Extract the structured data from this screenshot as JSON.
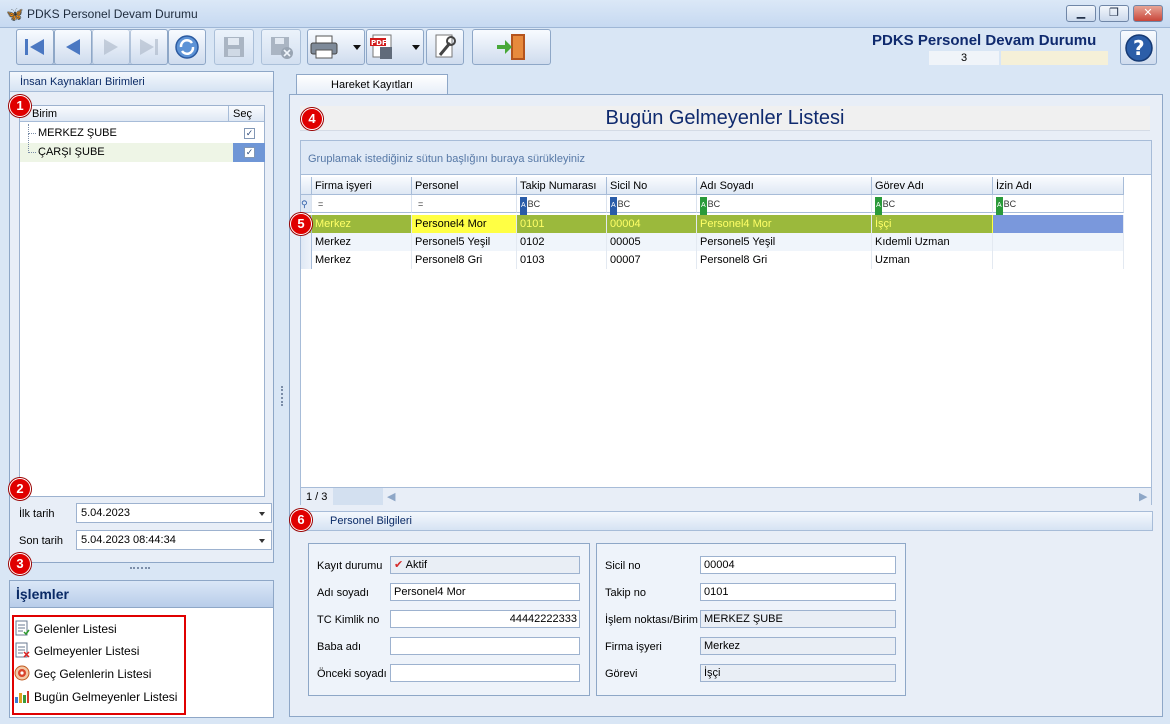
{
  "window": {
    "title": "PDKS Personel Devam Durumu",
    "minimize": "▁",
    "restore": "❐",
    "close": "✕"
  },
  "header": {
    "title": "PDKS Personel Devam Durumu",
    "count": "3",
    "help_icon": "help-icon"
  },
  "toolbar": {
    "icons": [
      "first-record-icon",
      "previous-record-icon",
      "next-record-icon",
      "last-record-icon",
      "refresh-icon",
      "save-icon",
      "delete-icon",
      "print-icon",
      "pdf-export-icon",
      "settings-icon",
      "exit-icon"
    ]
  },
  "left": {
    "caption": "İnsan Kaynakları Birimleri",
    "tree_header": {
      "col1": "Birim",
      "col2": "Seç"
    },
    "units": [
      {
        "label": "MERKEZ ŞUBE",
        "checked": "✓"
      },
      {
        "label": "ÇARŞI ŞUBE",
        "checked": "✓"
      }
    ],
    "first_date_label": "İlk tarih",
    "first_date_value": "5.04.2023",
    "last_date_label": "Son tarih",
    "last_date_value": "5.04.2023 08:44:34"
  },
  "operations": {
    "title": "İşlemler",
    "items": [
      {
        "label": "Gelenler Listesi",
        "icon": "list-arrived-icon"
      },
      {
        "label": "Gelmeyenler Listesi",
        "icon": "list-absent-icon"
      },
      {
        "label": "Geç Gelenlerin Listesi",
        "icon": "late-arrivals-icon"
      },
      {
        "label": "Bugün Gelmeyenler Listesi",
        "icon": "today-absent-chart-icon"
      }
    ]
  },
  "badges": [
    "1",
    "2",
    "3",
    "4",
    "5",
    "6"
  ],
  "main": {
    "tab": "Hareket Kayıtları",
    "list_title": "Bugün Gelmeyenler Listesi",
    "group_hint": "Gruplamak istediğiniz sütun başlığını buraya sürükleyiniz",
    "columns": [
      "Firma işyeri",
      "Personel",
      "Takip Numarası",
      "Sicil No",
      "Adı Soyadı",
      "Görev Adı",
      "İzin Adı"
    ],
    "filters": [
      "=",
      "=",
      "BC",
      "BC",
      "BC",
      "BC",
      "BC"
    ],
    "rows": [
      [
        "Merkez",
        "Personel4 Mor",
        "0101",
        "00004",
        "Personel4 Mor",
        "İşçi",
        ""
      ],
      [
        "Merkez",
        "Personel5 Yeşil",
        "0102",
        "00005",
        "Personel5 Yeşil",
        "Kıdemli Uzman",
        ""
      ],
      [
        "Merkez",
        "Personel8 Gri",
        "0103",
        "00007",
        "Personel8 Gri",
        "Uzman",
        ""
      ]
    ],
    "pager": "1 / 3"
  },
  "personel": {
    "title": "Personel Bilgileri",
    "kayit_durumu_label": "Kayıt durumu",
    "kayit_durumu_value": "Aktif",
    "adi_soyadi_label": "Adı soyadı",
    "adi_soyadi_value": "Personel4 Mor",
    "tc_label": "TC Kimlik no",
    "tc_value": "44442222333",
    "baba_adi_label": "Baba adı",
    "baba_adi_value": "",
    "onceki_soyadi_label": "Önceki soyadı",
    "onceki_soyadi_value": "",
    "sicil_label": "Sicil no",
    "sicil_value": "00004",
    "takip_label": "Takip no",
    "takip_value": "0101",
    "islem_label": "İşlem noktası/Birim",
    "islem_value": "MERKEZ ŞUBE",
    "firma_label": "Firma işyeri",
    "firma_value": "Merkez",
    "gorev_label": "Görevi",
    "gorev_value": "İşçi"
  }
}
